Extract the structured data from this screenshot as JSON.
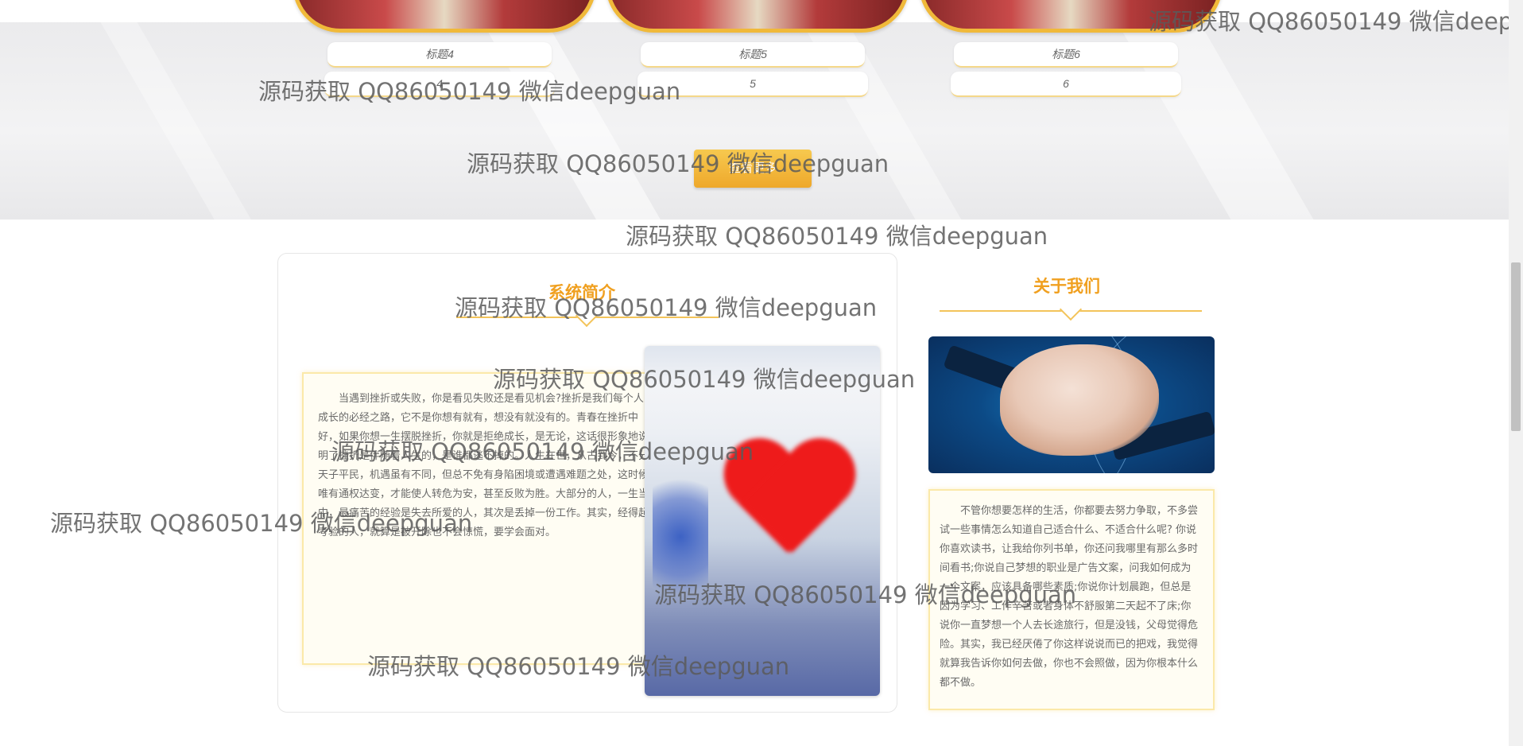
{
  "gallery": {
    "cards": [
      {
        "title": "标题4",
        "number": "4"
      },
      {
        "title": "标题5",
        "number": "5"
      },
      {
        "title": "标题6",
        "number": "6"
      }
    ],
    "more_button": "查看更多"
  },
  "intro": {
    "title": "系统简介",
    "text": "当遇到挫折或失败，你是看见失败还是看见机会?挫折是我们每个人成长的必经之路，它不是你想有就有，想没有就没有的。青春在挫折中好，如果你想一生摆脱挫折，你就是拒绝成长，是无论，这话很形象地说明了挫折是伴随着人生的，是谁都逃不掉的。人生在世，从古到今，不分天子平民，机遇虽有不同，但总不免有身陷困境或遭遇难题之处，这时候唯有通权达变，才能使人转危为安，甚至反败为胜。大部分的人，一生当中，最痛苦的经验是失去所爱的人，其次是丢掉一份工作。其实，经得起考验的人，就算是被开除也不会惊慌，要学会面对。"
  },
  "about": {
    "title": "关于我们",
    "text": "不管你想要怎样的生活，你都要去努力争取，不多尝试一些事情怎么知道自己适合什么、不适合什么呢? 你说你喜欢读书，让我给你列书单，你还问我哪里有那么多时间看书;你说自己梦想的职业是广告文案，问我如何成为一个文案，应该具备哪些素质;你说你计划晨跑，但总是因为学习、工作辛苦或者身体不舒服第二天起不了床;你说你一直梦想一个人去长途旅行，但是没钱，父母觉得危险。其实，我已经厌倦了你这样说说而已的把戏，我觉得就算我告诉你如何去做，你也不会照做，因为你根本什么都不做。"
  },
  "watermark": "源码获取 QQ86050149 微信deepguan",
  "watermark_clipped": "源码获取 QQ86050149 微信deepgu"
}
